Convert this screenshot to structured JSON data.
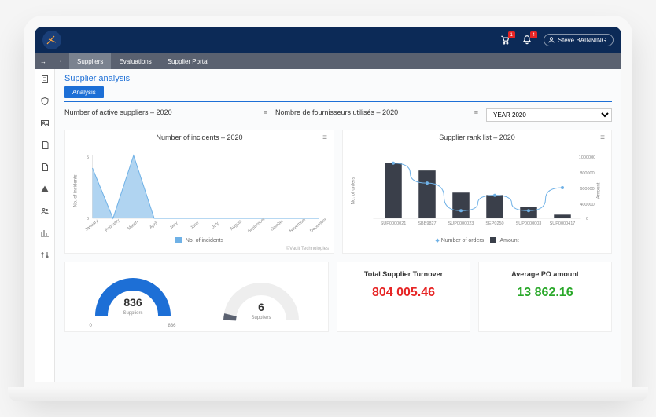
{
  "user": {
    "name": "Steve BAINNING"
  },
  "badges": {
    "cart": "1",
    "bell": "4"
  },
  "nav": {
    "items": [
      {
        "label": "Suppliers",
        "key": "sidebar-item-suppliers"
      },
      {
        "label": "Evaluations",
        "key": "sidebar-item-evaluations"
      },
      {
        "label": "Supplier Portal",
        "key": "sidebar-item-supplier-portal"
      }
    ]
  },
  "page": {
    "title": "Supplier analysis",
    "tab": "Analysis",
    "year_label": "YEAR 2020"
  },
  "kpi_headers": {
    "left": "Number of active suppliers – 2020",
    "right": "Nombre de fournisseurs utilisés – 2020"
  },
  "chart_data": [
    {
      "id": "incidents",
      "type": "area",
      "title": "Number of incidents – 2020",
      "ylabel": "No. of incidents",
      "ylim": [
        0,
        5
      ],
      "categories": [
        "January",
        "February",
        "March",
        "April",
        "May",
        "June",
        "July",
        "August",
        "September",
        "October",
        "November",
        "December"
      ],
      "values": [
        4,
        0,
        5,
        0,
        0,
        0,
        0,
        0,
        0,
        0,
        0,
        0
      ],
      "legend": "No. of incidents",
      "color": "#6fb1e6",
      "footnote": "©Vault Technologies"
    },
    {
      "id": "rank",
      "type": "bar-line",
      "title": "Supplier rank list – 2020",
      "categories": [
        "SUP0000021",
        "SBB9827",
        "SUP0000023",
        "SEP0250",
        "SUP0000003",
        "SUP0000417"
      ],
      "series": [
        {
          "name": "Amount",
          "type": "bar",
          "color": "#3a3f4a",
          "values": [
            900000,
            780000,
            420000,
            380000,
            180000,
            60000
          ]
        },
        {
          "name": "Number of orders",
          "type": "line",
          "color": "#6fb1e6",
          "values": [
            36,
            23,
            5,
            15,
            5,
            20
          ]
        }
      ],
      "y_left": {
        "label": "No. of orders",
        "lim": [
          0,
          40
        ]
      },
      "y_right": {
        "label": "Amount",
        "lim": [
          0,
          1000000
        ]
      }
    },
    {
      "id": "gauge_left",
      "type": "donut-gauge",
      "value": 836,
      "max": 836,
      "sublabel": "Suppliers",
      "color": "#1d6fd6",
      "scale_left": "0",
      "scale_right": "836"
    },
    {
      "id": "gauge_right",
      "type": "donut-gauge",
      "value": 6,
      "max": 836,
      "sublabel": "Suppliers",
      "color": "#5a6170"
    }
  ],
  "kpis": {
    "turnover": {
      "label": "Total Supplier Turnover",
      "value": "804 005.46"
    },
    "avg_po": {
      "label": "Average PO amount",
      "value": "13 862.16"
    }
  }
}
